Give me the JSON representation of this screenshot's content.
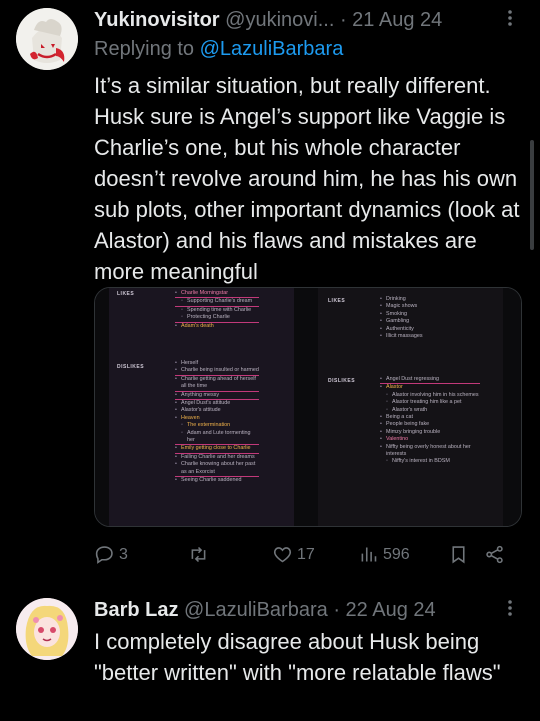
{
  "tweet1": {
    "display_name": "Yukinovisitor",
    "handle": "@yukinovi...",
    "date": "21 Aug 24",
    "replying_prefix": "Replying to",
    "replying_to": "@LazuliBarbara",
    "text": "It’s a similar situation, but really different. Husk sure is Angel’s support like Vaggie is Charlie’s one, but his whole character doesn’t revolve around him, he has his own sub plots, other important dynamics (look at Alastor) and his flaws and mistakes are more meaningful",
    "media": {
      "left": {
        "likes_header": "LIKES",
        "likes": [
          {
            "text": "Charlie Morningstar",
            "style": "pink ul"
          },
          {
            "text": "Supporting Charlie's dream",
            "style": "sub ul"
          },
          {
            "text": "Spending time with Charlie",
            "style": "sub"
          },
          {
            "text": "Protecting Charlie",
            "style": "sub ul"
          },
          {
            "text": "Adam's death",
            "style": "orange"
          }
        ],
        "dislikes_header": "DISLIKES",
        "dislikes": [
          {
            "text": "Herself",
            "style": ""
          },
          {
            "text": "Charlie being insulted or harmed",
            "style": "ul"
          },
          {
            "text": "Charlie getting ahead of herself all the time",
            "style": "ul"
          },
          {
            "text": "Anything messy",
            "style": "ul"
          },
          {
            "text": "Angel Dust's attitude",
            "style": ""
          },
          {
            "text": "Alastor's attitude",
            "style": ""
          },
          {
            "text": "Heaven",
            "style": "orange"
          },
          {
            "text": "The extermination",
            "style": "sub orange"
          },
          {
            "text": "Adam and Lute tormenting her",
            "style": "sub ul"
          },
          {
            "text": "Emily getting close to Charlie",
            "style": "orange ul"
          },
          {
            "text": "Failing Charlie and her dreams",
            "style": ""
          },
          {
            "text": "Charlie knowing about her past as an Exorcist",
            "style": "ul"
          },
          {
            "text": "Seeing Charlie saddened",
            "style": ""
          }
        ]
      },
      "right": {
        "likes_header": "LIKES",
        "likes": [
          {
            "text": "Drinking",
            "style": ""
          },
          {
            "text": "Magic shows",
            "style": ""
          },
          {
            "text": "Smoking",
            "style": ""
          },
          {
            "text": "Gambling",
            "style": ""
          },
          {
            "text": "Authenticity",
            "style": ""
          },
          {
            "text": "Illicit massages",
            "style": ""
          }
        ],
        "dislikes_header": "DISLIKES",
        "dislikes": [
          {
            "text": "Angel Dust regressing",
            "style": "ul"
          },
          {
            "text": "Alastor",
            "style": "orange"
          },
          {
            "text": "Alastor involving him in his schemes",
            "style": "sub"
          },
          {
            "text": "Alastor treating him like a pet",
            "style": "sub"
          },
          {
            "text": "Alastor's wrath",
            "style": "sub"
          },
          {
            "text": "Being a cat",
            "style": ""
          },
          {
            "text": "People being fake",
            "style": ""
          },
          {
            "text": "Mimzy bringing trouble",
            "style": ""
          },
          {
            "text": "Valentino",
            "style": "pink"
          },
          {
            "text": "Niffty being overly honest about her interests",
            "style": ""
          },
          {
            "text": "Niffty's interest in BDSM",
            "style": "sub"
          }
        ]
      }
    },
    "actions": {
      "replies": "3",
      "retweets": "",
      "likes": "17",
      "views": "596"
    }
  },
  "tweet2": {
    "display_name": "Barb Laz",
    "handle": "@LazuliBarbara",
    "date": "22 Aug 24",
    "text": "I completely disagree about Husk being \"better written\" with \"more relatable flaws\""
  },
  "icons": [
    "reply-icon",
    "retweet-icon",
    "like-icon",
    "views-icon",
    "bookmark-icon",
    "share-icon",
    "more-icon"
  ]
}
